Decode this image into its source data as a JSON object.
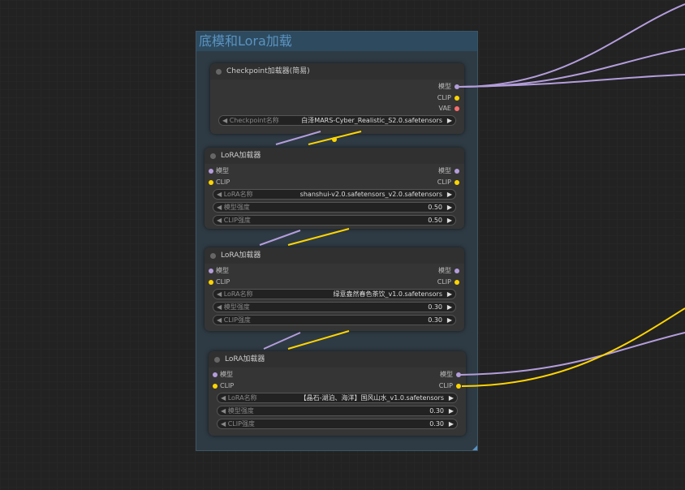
{
  "group": {
    "title": "底模和Lora加载"
  },
  "colors": {
    "model": "#b39ddb",
    "clip": "#ffd500",
    "vae": "#ff6e6e"
  },
  "nodes": [
    {
      "title": "Checkpoint加载器(简易)",
      "inputs": [],
      "outputs": [
        "模型",
        "CLIP",
        "VAE"
      ],
      "widgets": [
        {
          "label": "Checkpoint名称",
          "value": "白泽MARS-Cyber_Realistic_S2.0.safetensors"
        }
      ]
    },
    {
      "title": "LoRA加载器",
      "inputs": [
        "模型",
        "CLIP"
      ],
      "outputs": [
        "模型",
        "CLIP"
      ],
      "widgets": [
        {
          "label": "LoRA名称",
          "value": "shanshui-v2.0.safetensors_v2.0.safetensors"
        },
        {
          "label": "模型强度",
          "value": "0.50"
        },
        {
          "label": "CLIP强度",
          "value": "0.50"
        }
      ]
    },
    {
      "title": "LoRA加载器",
      "inputs": [
        "模型",
        "CLIP"
      ],
      "outputs": [
        "模型",
        "CLIP"
      ],
      "widgets": [
        {
          "label": "LoRA名称",
          "value": "绿意盎然春色茶饮_v1.0.safetensors"
        },
        {
          "label": "模型强度",
          "value": "0.30"
        },
        {
          "label": "CLIP强度",
          "value": "0.30"
        }
      ]
    },
    {
      "title": "LoRA加载器",
      "inputs": [
        "模型",
        "CLIP"
      ],
      "outputs": [
        "模型",
        "CLIP"
      ],
      "widgets": [
        {
          "label": "LoRA名称",
          "value": "【晶石-湖泊、海洋】国风山水_v1.0.safetensors"
        },
        {
          "label": "模型强度",
          "value": "0.30"
        },
        {
          "label": "CLIP强度",
          "value": "0.30"
        }
      ]
    }
  ],
  "arrows": {
    "left": "◀",
    "right": "▶"
  }
}
